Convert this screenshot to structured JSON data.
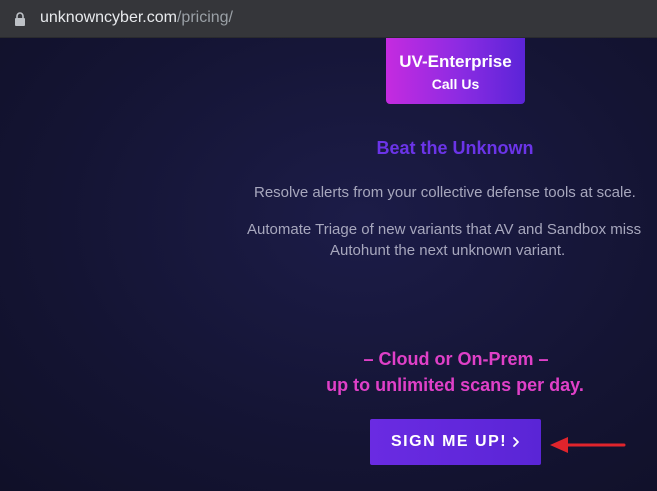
{
  "browser": {
    "url_domain": "unknowncyber.com",
    "url_path": "/pricing/",
    "lock_icon": "lock-icon"
  },
  "plan": {
    "name": "UV-Enterprise",
    "cta": "Call Us",
    "gradient_colors": [
      "#c52be0",
      "#5b24d8"
    ]
  },
  "content": {
    "headline": "Beat the Unknown",
    "description_line_1": "Resolve alerts from your collective defense tools at scale.",
    "description_line_2": "Automate Triage of new variants that AV and Sandbox miss",
    "description_line_3": "Autohunt the next unknown variant.",
    "deployment_line_1": "– Cloud or On-Prem –",
    "deployment_line_2": "up to unlimited scans per day."
  },
  "signup": {
    "label": "SIGN ME UP!",
    "icon": "chevron-right-icon"
  },
  "annotation": {
    "icon": "red-arrow-icon",
    "color": "#e0242c"
  },
  "colors": {
    "accent_purple": "#6b34e8",
    "accent_pink": "#e040c8",
    "background": "#141433"
  }
}
